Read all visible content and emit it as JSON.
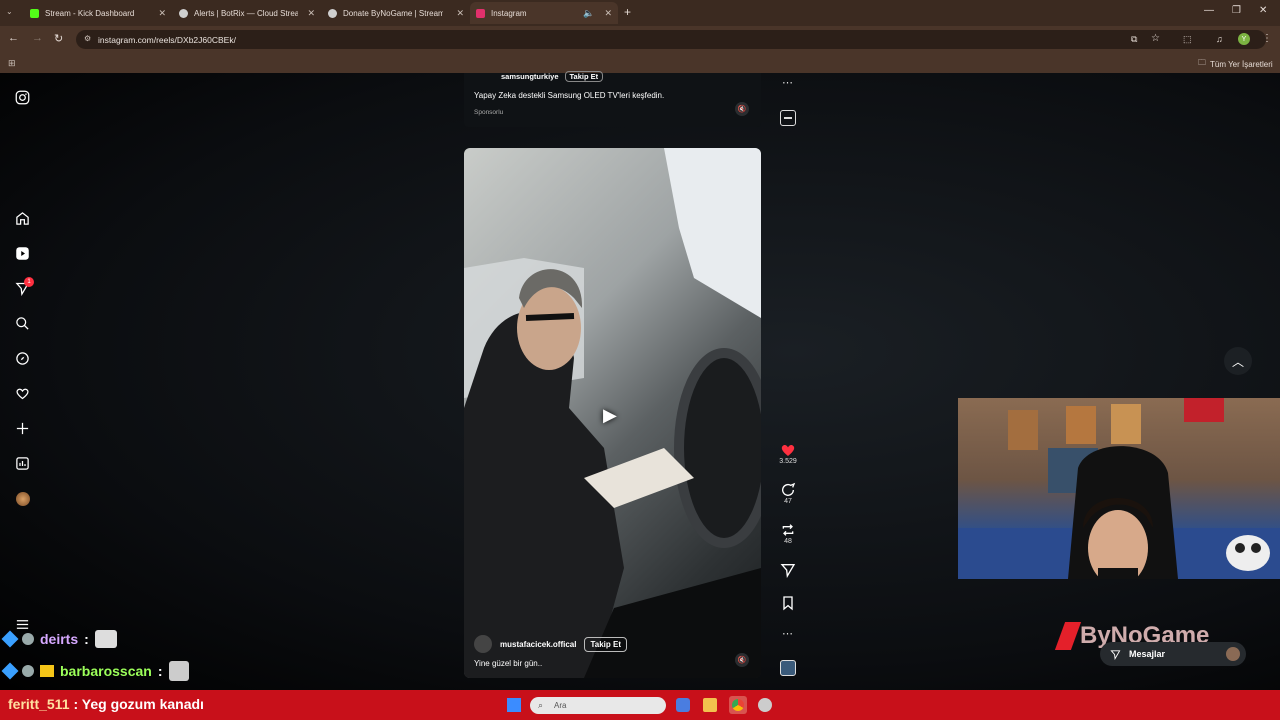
{
  "browser": {
    "tabs": [
      {
        "title": "Stream - Kick Dashboard",
        "icon": "kick-icon",
        "color": "#53fc18"
      },
      {
        "title": "Alerts | BotRix — Cloud Stream",
        "icon": "botrix-icon",
        "color": "#cfcfcf"
      },
      {
        "title": "Donate ByNoGame | Streamer",
        "icon": "bynogame-icon",
        "color": "#cfcfcf"
      },
      {
        "title": "Instagram",
        "icon": "instagram-icon",
        "color": "#e1306c"
      }
    ],
    "url": "instagram.com/reels/DXb2J60CBEk/",
    "bookmarks_all": "Tüm Yer İşaretleri",
    "profile_initial": "Y"
  },
  "sidebar": {
    "notification_badge": "1"
  },
  "ad": {
    "account": "samsungturkiye",
    "follow_label": "Takip Et",
    "caption": "Yapay Zeka destekli Samsung OLED TV'leri keşfedin.",
    "sponsored": "Sponsorlu"
  },
  "reel": {
    "account": "mustafacicek.offical",
    "follow_label": "Takip Et",
    "caption": "Yine güzel bir gün..",
    "likes": "3.529",
    "comments": "47",
    "reposts": "48"
  },
  "messages_label": "Mesajlar",
  "overlay": {
    "brand": "ByNoGame",
    "chat": [
      {
        "user": "deirts",
        "text": ":",
        "color": "#d6a8ff"
      },
      {
        "user": "barbarosscan",
        "text": ":",
        "color": "#9cff5a"
      }
    ],
    "ticker_user": "feritt_511",
    "ticker_text": ": Yeg gozum kanadı"
  },
  "taskbar": {
    "search_placeholder": "Ara"
  },
  "colors": {
    "accent_like": "#ff3040",
    "ticker_bg": "#c8101a",
    "chrome_bg": "#4a3529"
  }
}
